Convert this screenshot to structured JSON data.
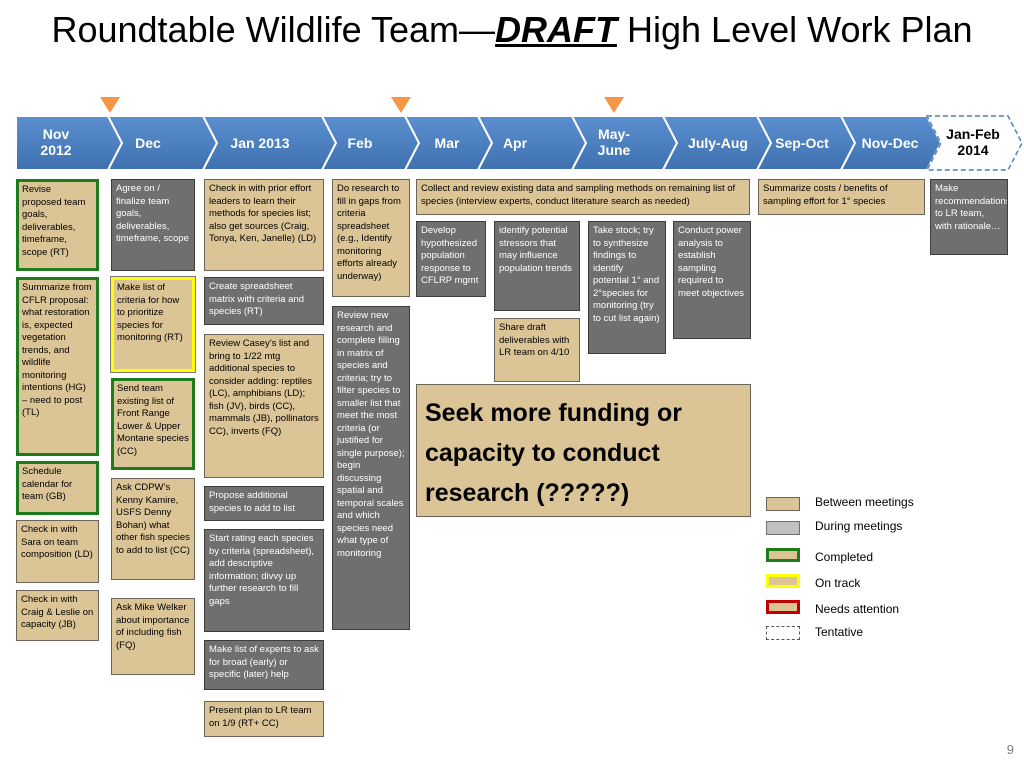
{
  "title": {
    "part1": "Roundtable Wildlife Team—",
    "draft": "DRAFT",
    "part2": " High Level Work Plan"
  },
  "timeline": [
    {
      "line1": "Nov",
      "line2": "2012"
    },
    {
      "line1": "Dec",
      "line2": ""
    },
    {
      "line1": "Jan 2013",
      "line2": ""
    },
    {
      "line1": "Feb",
      "line2": ""
    },
    {
      "line1": "Mar",
      "line2": ""
    },
    {
      "line1": "Apr",
      "line2": ""
    },
    {
      "line1": "May-",
      "line2": "June"
    },
    {
      "line1": "July-Aug",
      "line2": ""
    },
    {
      "line1": "Sep-Oct",
      "line2": ""
    },
    {
      "line1": "Nov-Dec",
      "line2": ""
    },
    {
      "line1": "Jan-Feb",
      "line2": "2014"
    }
  ],
  "tasks": [
    "Revise proposed team goals, deliverables, timeframe, scope (RT)",
    "Summarize from CFLR proposal: what restoration is, expected vegetation trends, and wildlife monitoring intentions (HG) – need to post (TL)",
    "Schedule calendar for team (GB)",
    "Check in with Sara on team composition (LD)",
    "Check in with Craig & Leslie on capacity (JB)",
    "Agree on / finalize team goals, deliverables, timeframe, scope",
    "Make list of criteria for how to prioritize species for monitoring (RT)",
    "Send team existing list of Front Range Lower & Upper Montane species (CC)",
    "Ask CDPW’s Kenny Kamire, USFS Denny Bohan) what other fish species to add to list (CC)",
    "Ask Mike Welker about importance of including fish (FQ)",
    "Check in with prior effort leaders to learn their methods for species list; also get sources (Craig, Tonya, Ken, Janelle) (LD)",
    "Create spreadsheet matrix  with criteria and species (RT)",
    "Review Casey’s list and bring to 1/22 mtg additional species to consider adding: reptiles (LC), amphibians (LD); fish (JV), birds (CC), mammals (JB), pollinators CC), inverts (FQ)",
    "Propose additional species to add to list",
    "Start rating each species by criteria (spreadsheet), add descriptive information; divvy up further research to fill gaps",
    "Make list of experts to ask for broad (early) or specific (later) help",
    "Present plan to LR team on 1/9 (RT+ CC)",
    "Do research to fill in gaps from criteria spreadsheet (e.g., Identify monitoring efforts already underway)",
    "Review new research and complete filling in matrix of species and criteria; try to filter species to smaller list that meet the most criteria (or justified for single purpose); begin discussing spatial and temporal scales and which species need what type of monitoring",
    "Collect and review existing data and sampling methods  on remaining list of species (interview experts, conduct literature search as needed)",
    "Develop hypothesized population response to CFLRP mgmt",
    "identify potential stressors that may influence population trends",
    "Share draft deliverables with LR team on 4/10",
    "Take stock; try to synthesize findings to identify potential 1° and 2°species for monitoring (try to cut list again)",
    "Conduct power analysis to establish sampling required to meet objectives",
    "Summarize costs / benefits of sampling effort for 1° species",
    "Make recommendations to LR team, with rationale…"
  ],
  "funding_box": "Seek more funding or capacity to conduct research  (?????)",
  "legend": [
    {
      "label": "Between meetings",
      "icon": "tan-box"
    },
    {
      "label": "During meetings",
      "icon": "gray-box"
    },
    {
      "label": "Completed",
      "icon": "green-border-box"
    },
    {
      "label": "On track",
      "icon": "yellow-border-box"
    },
    {
      "label": "Needs attention",
      "icon": "red-border-box"
    },
    {
      "label": "Tentative",
      "icon": "dashed-box"
    }
  ],
  "colors": {
    "timeline_blue": "#4f81bd",
    "tan": "#dbc596",
    "gray": "#6f6f6f",
    "completed": "#1e7b1e",
    "on_track": "#ffff00",
    "needs_attention": "#c00000",
    "marker": "#f79646"
  },
  "page_number": "9"
}
